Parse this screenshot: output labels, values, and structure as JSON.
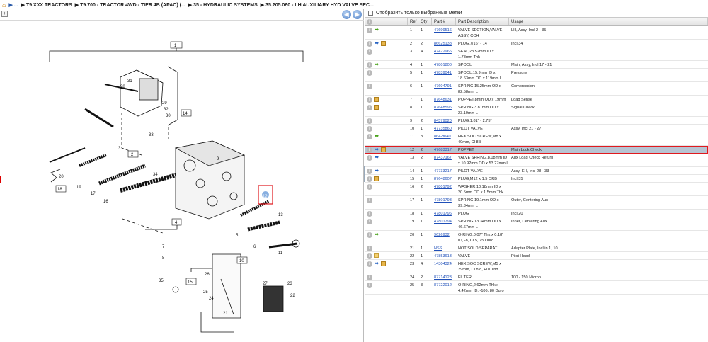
{
  "breadcrumb": {
    "home": "⌂",
    "ellipsis": "▶ ...",
    "items": [
      "▶ T9.XXX TRACTORS",
      "▶ T9.700 - TRACTOR 4WD - TIER 4B (APAC) (...",
      "▶ 35 - HYDRAULIC SYSTEMS",
      "▶ 35.205.060 - LH AUXILIARY HYD VALVE SEC..."
    ]
  },
  "nav": {
    "back": "◀",
    "forward": "▶",
    "zoom": "+"
  },
  "filter": {
    "label": "Отобразить только выбранные метки"
  },
  "columns": [
    "",
    "Ref",
    "Qty",
    "Part #",
    "Part Description",
    "Usage"
  ],
  "diagram_labels": [
    "1",
    "2",
    "3",
    "4",
    "5",
    "6",
    "7",
    "8",
    "9",
    "10",
    "11",
    "12",
    "13",
    "14",
    "15",
    "16",
    "17",
    "18",
    "19",
    "20",
    "21",
    "22",
    "23",
    "24",
    "25",
    "26",
    "27",
    "28",
    "29",
    "30",
    "31",
    "32",
    "33",
    "34",
    "35"
  ],
  "parts": [
    {
      "ref": "1",
      "qty": "1",
      "part": "47699516",
      "desc": "VALVE SECTION,VALVE ASSY, CCH",
      "usage": "LH, Assy, Incl 2 - 35",
      "icons": [
        "info",
        "green"
      ]
    },
    {
      "ref": "2",
      "qty": "2",
      "part": "86625138",
      "desc": "PLUG,7/16\" - 14",
      "usage": "Incl 34",
      "icons": [
        "info",
        "blue",
        "box"
      ]
    },
    {
      "ref": "3",
      "qty": "4",
      "part": "47422966",
      "desc": "SEAL,23.52mm ID x 1.78mm Thk",
      "usage": "",
      "icons": [
        "info"
      ]
    },
    {
      "ref": "4",
      "qty": "1",
      "part": "47801800",
      "desc": "SPOOL",
      "usage": "Main, Assy, Incl 17 - 21",
      "icons": [
        "info",
        "green"
      ]
    },
    {
      "ref": "5",
      "qty": "1",
      "part": "47839041",
      "desc": "SPOOL,15.9mm ID x 18.63mm OD x 119mm L",
      "usage": "Pressure",
      "icons": [
        "info"
      ]
    },
    {
      "ref": "6",
      "qty": "1",
      "part": "47604791",
      "desc": "SPRING,15.25mm OD x 82.58mm L",
      "usage": "Compression",
      "icons": [
        "info"
      ]
    },
    {
      "ref": "7",
      "qty": "1",
      "part": "87648631",
      "desc": "POPPET,8mm OD x 19mm L",
      "usage": "Load Sense",
      "icons": [
        "info",
        "box"
      ]
    },
    {
      "ref": "8",
      "qty": "1",
      "part": "87648596",
      "desc": "SPRING,3.81mm OD x 23.19mm L",
      "usage": "Signal Check",
      "icons": [
        "info",
        "box"
      ]
    },
    {
      "ref": "9",
      "qty": "2",
      "part": "84579020",
      "desc": "PLUG,1.81\" - 2.75\"",
      "usage": "",
      "icons": [
        "info"
      ]
    },
    {
      "ref": "10",
      "qty": "1",
      "part": "47735860",
      "desc": "PILOT VALVE",
      "usage": "Assy, Incl 21 - 27",
      "icons": [
        "info"
      ]
    },
    {
      "ref": "11",
      "qty": "3",
      "part": "864-8040",
      "desc": "HEX SOC SCREW,M8 x 40mm, Cl 8.8",
      "usage": "",
      "icons": [
        "info",
        "green"
      ]
    },
    {
      "ref": "12",
      "qty": "2",
      "part": "47683317",
      "desc": "POPPET",
      "usage": "Main Lock Check",
      "icons": [
        "info",
        "blue",
        "box"
      ],
      "selected": true
    },
    {
      "ref": "13",
      "qty": "2",
      "part": "87437167",
      "desc": "VALVE SPRING,8.08mm ID x 10.92mm OD x 53.27mm L",
      "usage": "Aux Load Check Return",
      "icons": [
        "info",
        "blue"
      ]
    },
    {
      "ref": "14",
      "qty": "1",
      "part": "47733217",
      "desc": "PILOT VALVE",
      "usage": "Assy, EH, Incl 28 - 33",
      "icons": [
        "info",
        "blue"
      ]
    },
    {
      "ref": "15",
      "qty": "1",
      "part": "87648607",
      "desc": "PLUG,M12 x 1.5 ORB",
      "usage": "Incl 35",
      "icons": [
        "info",
        "box"
      ]
    },
    {
      "ref": "16",
      "qty": "2",
      "part": "47801792",
      "desc": "WASHER,10.18mm ID x 20.5mm OD x 1.5mm Thk",
      "usage": "",
      "icons": [
        "info"
      ]
    },
    {
      "ref": "17",
      "qty": "1",
      "part": "47801793",
      "desc": "SPRING,19.1mm OD x 39.34mm L",
      "usage": "Outer, Centering Aux",
      "icons": [
        "info"
      ]
    },
    {
      "ref": "18",
      "qty": "1",
      "part": "47801796",
      "desc": "PLUG",
      "usage": "Incl 20",
      "icons": [
        "info"
      ]
    },
    {
      "ref": "19",
      "qty": "1",
      "part": "47801794",
      "desc": "SPRING,13.34mm OD x 46.67mm L",
      "usage": "Inner, Centering Aux",
      "icons": [
        "info"
      ]
    },
    {
      "ref": "20",
      "qty": "1",
      "part": "9626932",
      "desc": "O-RING,0.07\" Thk x 0.18\" ID, -8, CI 5, 75 Duro",
      "usage": "",
      "icons": [
        "info",
        "green"
      ]
    },
    {
      "ref": "21",
      "qty": "1",
      "part": "NSS",
      "desc": "NOT SOLD SEPARAT",
      "usage": "Adapter Plate, Incl in 1, 10",
      "icons": [
        "info"
      ]
    },
    {
      "ref": "22",
      "qty": "1",
      "part": "47853613",
      "desc": "VALVE",
      "usage": "Pilot Head",
      "icons": [
        "info",
        "boxy"
      ]
    },
    {
      "ref": "23",
      "qty": "4",
      "part": "14304324",
      "desc": "HEX SOC SCREW,M5 x 29mm, Cl 8.8, Full Thd",
      "usage": "",
      "icons": [
        "info",
        "blue",
        "box"
      ]
    },
    {
      "ref": "24",
      "qty": "2",
      "part": "87714123",
      "desc": "FILTER",
      "usage": "100 - 150 Micron",
      "icons": [
        "info"
      ]
    },
    {
      "ref": "25",
      "qty": "3",
      "part": "87722012",
      "desc": "O-RING,2.62mm Thk x 4.42mm ID, -106, 80 Duro",
      "usage": "",
      "icons": [
        "info"
      ]
    }
  ]
}
